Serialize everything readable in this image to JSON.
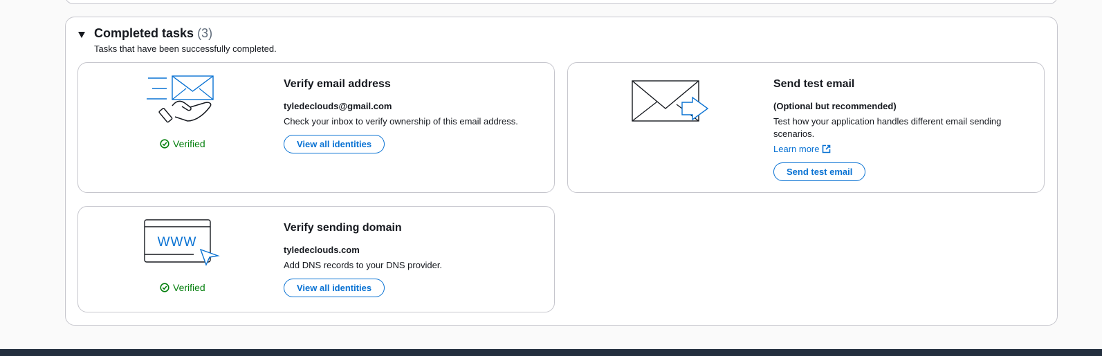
{
  "section": {
    "title": "Completed tasks",
    "count": "(3)",
    "description": "Tasks that have been successfully completed."
  },
  "cards": {
    "verify_email": {
      "title": "Verify email address",
      "subtitle": "tyledeclouds@gmail.com",
      "text": "Check your inbox to verify ownership of this email address.",
      "button_label": "View all identities",
      "status": "Verified",
      "icon": "email-verify-illustration"
    },
    "send_test": {
      "title": "Send test email",
      "subtitle": "(Optional but recommended)",
      "text": "Test how your application handles different email sending scenarios.",
      "link_label": "Learn more",
      "button_label": "Send test email",
      "icon": "send-email-illustration"
    },
    "verify_domain": {
      "title": "Verify sending domain",
      "subtitle": "tyledeclouds.com",
      "text": "Add DNS records to your DNS provider.",
      "button_label": "View all identities",
      "status": "Verified",
      "illus_text": "WWW",
      "icon": "domain-browser-illustration"
    }
  },
  "colors": {
    "accent": "#0972d3",
    "success": "#037f0c",
    "border": "#c6c6cd",
    "text": "#16191f"
  }
}
